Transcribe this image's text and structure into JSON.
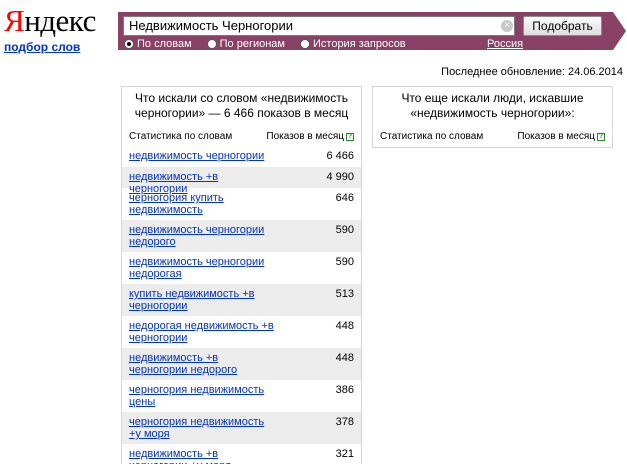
{
  "logo": "Яндекс",
  "subtitle": "подбор слов",
  "search": {
    "value": "Недвижимость Черногории",
    "submit_label": "Подобрать",
    "clear_glyph": "×",
    "radios": [
      {
        "label": "По словам",
        "checked": true
      },
      {
        "label": "По регионам",
        "checked": false
      },
      {
        "label": "История запросов",
        "checked": false
      }
    ],
    "region": "Россия"
  },
  "updated": "Последнее обновление: 24.06.2014",
  "left_panel": {
    "title": "Что искали со словом «недвижимость черногории» — 6 466 показов в месяц",
    "col_words": "Статистика по словам",
    "col_shows": "Показов в месяц",
    "help_glyph": "?",
    "rows": [
      {
        "query": "недвижимость черногории",
        "count": "6 466"
      },
      {
        "query": "недвижимость +в черногории",
        "count": "4 990"
      },
      {
        "query": "черногория купить недвижимость",
        "count": "646"
      },
      {
        "query": "недвижимость черногории недорого",
        "count": "590"
      },
      {
        "query": "недвижимость черногории недорогая",
        "count": "590"
      },
      {
        "query": "купить недвижимость +в черногории",
        "count": "513"
      },
      {
        "query": "недорогая недвижимость +в черногории",
        "count": "448"
      },
      {
        "query": "недвижимость +в черногории недорого",
        "count": "448"
      },
      {
        "query": "черногория недвижимость цены",
        "count": "386"
      },
      {
        "query": "черногория недвижимость +у моря",
        "count": "378"
      },
      {
        "query": "недвижимость +в черногории +у моря",
        "count": "321"
      }
    ]
  },
  "right_panel": {
    "title": "Что еще искали люди, искавшие «недвижимость черногории»:",
    "col_words": "Статистика по словам",
    "col_shows": "Показов в месяц",
    "help_glyph": "?"
  },
  "colors": {
    "bar": "#8a4166",
    "link": "#0033cc",
    "logo_red": "#ff0000"
  }
}
